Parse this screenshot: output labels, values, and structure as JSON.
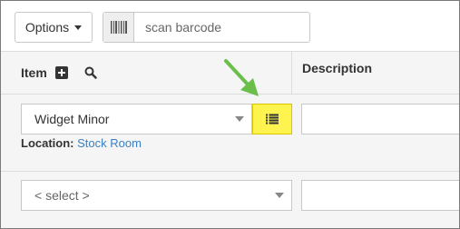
{
  "toolbar": {
    "options_label": "Options",
    "scan_placeholder": "scan barcode"
  },
  "table": {
    "columns": {
      "item": "Item",
      "description": "Description"
    },
    "rows": [
      {
        "item_value": "Widget Minor",
        "location_label": "Location:",
        "location_value": "Stock Room"
      },
      {
        "item_value": "< select >"
      }
    ]
  },
  "colors": {
    "highlight": "#fff44f",
    "arrow": "#6abf4b",
    "link": "#3c7fc1"
  },
  "icons": {
    "scan": "barcode-icon",
    "add": "plus-square-icon",
    "search": "search-icon",
    "list": "list-icon",
    "annotation": "arrow-icon"
  }
}
